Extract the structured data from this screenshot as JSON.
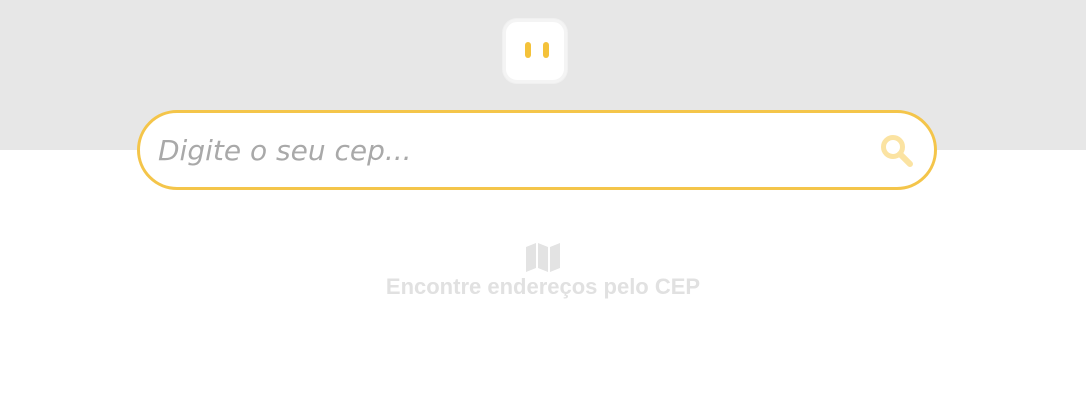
{
  "header": {
    "logo_icon": "app-logo-icon",
    "background_color": "#e7e7e7",
    "accent_color": "#f4c23a"
  },
  "search": {
    "placeholder": "Digite o seu cep...",
    "value": "",
    "button_icon": "search-icon",
    "border_color": "#f4c54a"
  },
  "empty_state": {
    "icon": "map-icon",
    "text": "Encontre endereços pelo CEP",
    "text_color": "#e1e1e1"
  }
}
